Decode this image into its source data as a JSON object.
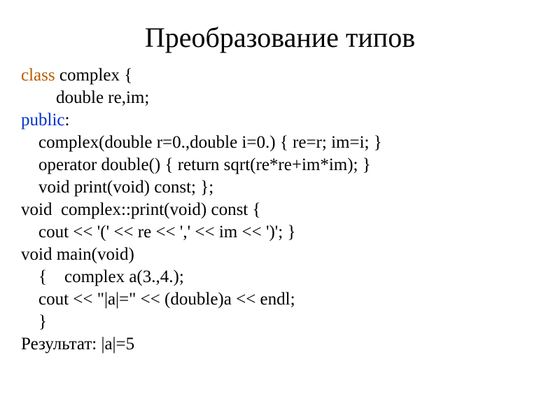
{
  "title": "Преобразование типов",
  "code": {
    "kw_class": "class",
    "l1": " complex {",
    "l2": "        double re,im;",
    "kw_public": "public",
    "l3": ":",
    "l4": "    complex(double r=0.,double i=0.) { re=r; im=i; }",
    "l5": "    operator double() { return sqrt(re*re+im*im); }",
    "l6": "    void print(void) const; };",
    "l7": "void  complex::print(void) const {",
    "l8": "    cout << '(' << re << ',' << im << ')'; }",
    "l9": "void main(void)",
    "l10": "    {    complex a(3.,4.);",
    "l11": "    cout << \"|a|=\" << (double)a << endl;",
    "l12": "    }",
    "l13": "Результат: |a|=5"
  }
}
